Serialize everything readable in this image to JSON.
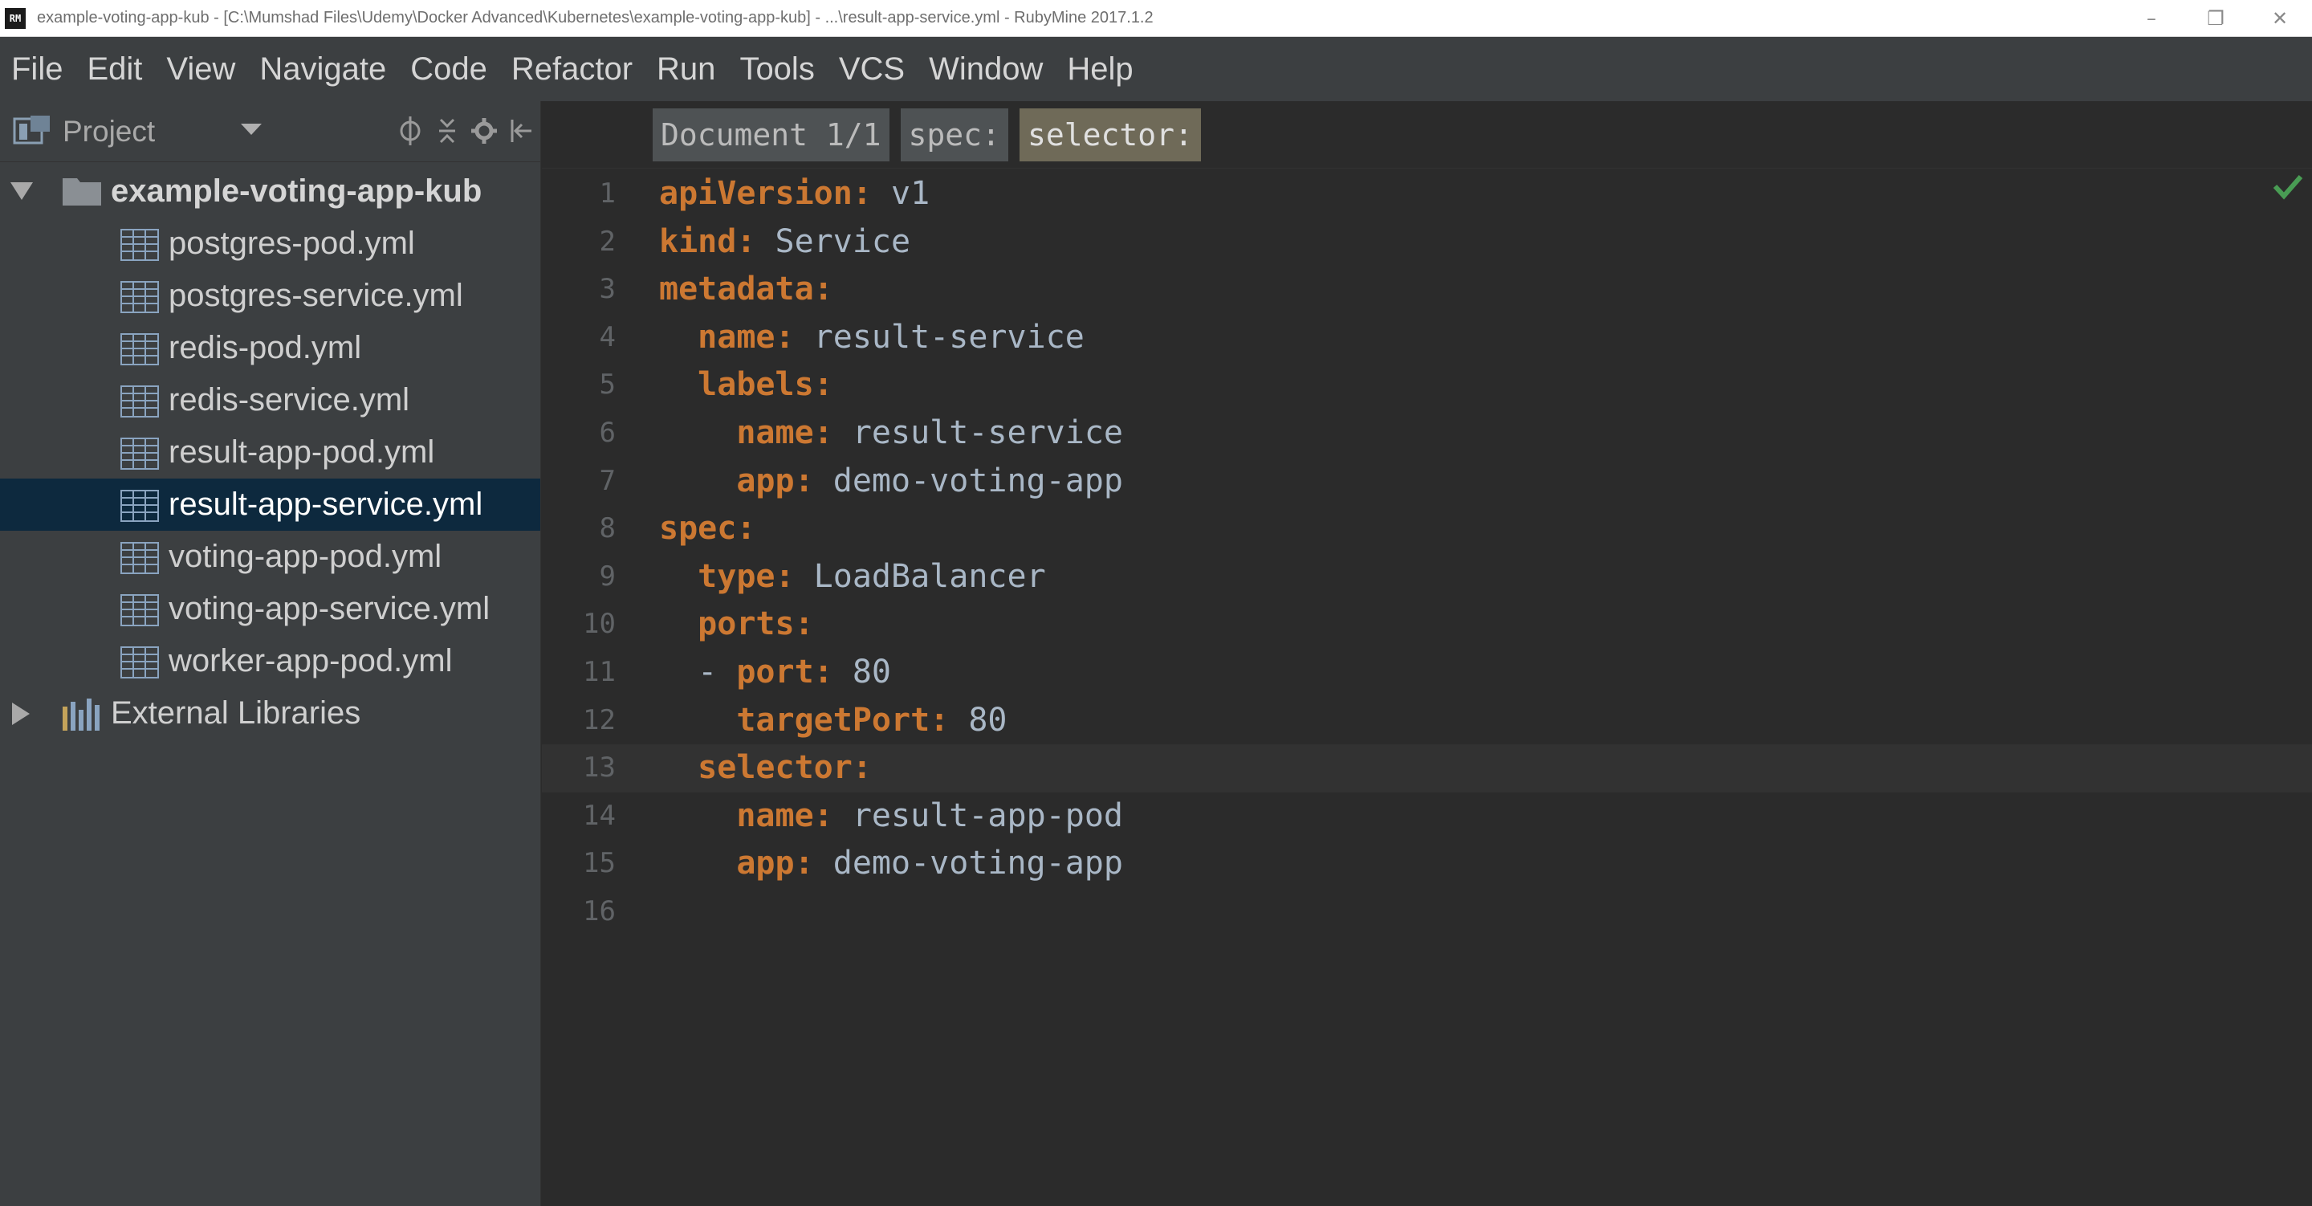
{
  "window": {
    "title": "example-voting-app-kub - [C:\\Mumshad Files\\Udemy\\Docker Advanced\\Kubernetes\\example-voting-app-kub] - ...\\result-app-service.yml - RubyMine 2017.1.2",
    "app_icon_text": "RM",
    "controls": {
      "minimize": "–",
      "restore": "❐",
      "close": "✕"
    }
  },
  "menu": {
    "items": [
      "File",
      "Edit",
      "View",
      "Navigate",
      "Code",
      "Refactor",
      "Run",
      "Tools",
      "VCS",
      "Window",
      "Help"
    ]
  },
  "project": {
    "label": "Project",
    "root": "example-voting-app-kub",
    "files": [
      "postgres-pod.yml",
      "postgres-service.yml",
      "redis-pod.yml",
      "redis-service.yml",
      "result-app-pod.yml",
      "result-app-service.yml",
      "voting-app-pod.yml",
      "voting-app-service.yml",
      "worker-app-pod.yml"
    ],
    "selected_file": "result-app-service.yml",
    "external": "External Libraries"
  },
  "editor": {
    "breadcrumbs": [
      "Document 1/1",
      "spec:",
      "selector:"
    ],
    "line_numbers": [
      "1",
      "2",
      "3",
      "4",
      "5",
      "6",
      "7",
      "8",
      "9",
      "10",
      "11",
      "12",
      "13",
      "14",
      "15",
      "16"
    ],
    "current_line": 13,
    "lines": [
      {
        "indent": "",
        "key": "apiVersion:",
        "value": " v1"
      },
      {
        "indent": "",
        "key": "kind:",
        "value": " Service"
      },
      {
        "indent": "",
        "key": "metadata:",
        "value": ""
      },
      {
        "indent": "  ",
        "key": "name:",
        "value": " result-service"
      },
      {
        "indent": "  ",
        "key": "labels:",
        "value": ""
      },
      {
        "indent": "    ",
        "key": "name:",
        "value": " result-service"
      },
      {
        "indent": "    ",
        "key": "app:",
        "value": " demo-voting-app"
      },
      {
        "indent": "",
        "key": "spec:",
        "value": ""
      },
      {
        "indent": "  ",
        "key": "type:",
        "value": " LoadBalancer"
      },
      {
        "indent": "  ",
        "key": "ports:",
        "value": ""
      },
      {
        "indent": "  - ",
        "key": "port:",
        "value": " 80"
      },
      {
        "indent": "    ",
        "key": "targetPort:",
        "value": " 80"
      },
      {
        "indent": "  ",
        "key": "selector:",
        "value": ""
      },
      {
        "indent": "    ",
        "key": "name:",
        "value": " result-app-pod"
      },
      {
        "indent": "    ",
        "key": "app:",
        "value": " demo-voting-app"
      },
      {
        "indent": "",
        "key": "",
        "value": ""
      }
    ]
  },
  "colors": {
    "yaml_key": "#cc7832",
    "yaml_value": "#a9b7c6",
    "selection": "#0d293e",
    "check": "#499c54"
  },
  "icons": {
    "file": "yaml-file-icon",
    "folder": "folder-icon",
    "libraries": "external-libraries-icon",
    "inspection": "inspection-ok-check-icon"
  }
}
